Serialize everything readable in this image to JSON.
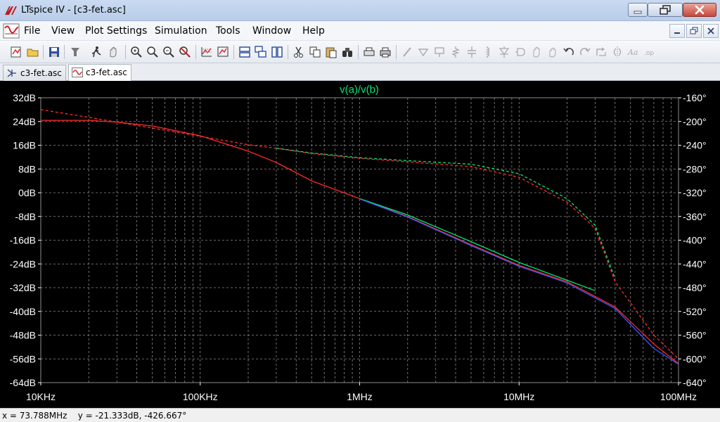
{
  "window": {
    "title": "LTspice IV - [c3-fet.asc]",
    "logo_icon": "ltspice-logo-icon",
    "controls": [
      "minimize-icon",
      "maximize-icon",
      "close-icon"
    ]
  },
  "menu": {
    "items": [
      "File",
      "View",
      "Plot Settings",
      "Simulation",
      "Tools",
      "Window",
      "Help"
    ],
    "mdi_controls": [
      "minimize-icon",
      "restore-icon",
      "close-icon"
    ]
  },
  "toolbar": {
    "icons": [
      "new-schematic-icon",
      "open-icon",
      "save-icon",
      "control-panel-icon",
      "run-icon",
      "halt-icon",
      "zoom-in-icon",
      "zoom-area-icon",
      "zoom-out-icon",
      "zoom-cancel-icon",
      "autorange-icon",
      "zoom-full-icon",
      "tile-horizontal-icon",
      "cascade-icon",
      "tile-vertical-icon",
      "cut-icon",
      "copy-icon",
      "paste-icon",
      "find-icon",
      "print-preview-icon",
      "print-icon",
      "wire-icon",
      "ground-icon",
      "label-icon",
      "resistor-icon",
      "capacitor-icon",
      "inductor-icon",
      "diode-icon",
      "component-icon",
      "move-icon",
      "drag-icon",
      "undo-icon",
      "redo-icon",
      "rotate-icon",
      "mirror-icon",
      "text-icon",
      "spice-directive-icon"
    ]
  },
  "tabs": [
    {
      "label": "c3-fet.asc",
      "icon": "schematic-icon",
      "active": false
    },
    {
      "label": "c3-fet.asc",
      "icon": "waveform-icon",
      "active": true
    }
  ],
  "status": {
    "text": "x = 73.788MHz    y = -21.333dB, -426.667°"
  },
  "colors": {
    "plot_background": "#000000",
    "grid": "#8c8c8c",
    "trace_green": "#00e676",
    "trace_red": "#ff2a2a",
    "trace_blue": "#3a5bff",
    "trace_magenta": "#e838ff",
    "trace_yellow": "#e6e600",
    "axis_text": "#ffffff"
  },
  "chart_data": {
    "type": "line",
    "title": "v(a)/v(b)",
    "xscale": "log",
    "x_ticks": [
      "10KHz",
      "100KHz",
      "1MHz",
      "10MHz",
      "100MHz"
    ],
    "xlim": [
      10000,
      100000000
    ],
    "y_left": {
      "ticks": [
        "32dB",
        "24dB",
        "16dB",
        "8dB",
        "0dB",
        "-8dB",
        "-16dB",
        "-24dB",
        "-32dB",
        "-40dB",
        "-48dB",
        "-56dB",
        "-64dB"
      ],
      "range": [
        -64,
        32
      ]
    },
    "y_right": {
      "ticks": [
        "-160°",
        "-200°",
        "-240°",
        "-280°",
        "-320°",
        "-360°",
        "-400°",
        "-440°",
        "-480°",
        "-520°",
        "-560°",
        "-600°",
        "-640°"
      ],
      "range": [
        -640,
        -160
      ]
    },
    "grid": true,
    "series": [
      {
        "style": "solid",
        "axis": "left",
        "color": "#ff2a2a",
        "x": [
          10000,
          20000,
          30000,
          50000,
          100000,
          200000,
          300000,
          500000,
          1000000,
          2000000,
          5000000,
          10000000,
          20000000,
          40000000,
          70000000,
          100000000
        ],
        "y": [
          24.4,
          24.4,
          23.8,
          22.5,
          19.2,
          14.0,
          10.2,
          4.0,
          -2.0,
          -8.0,
          -17.5,
          -24.5,
          -30.0,
          -38.5,
          -51.0,
          -57.6
        ]
      },
      {
        "style": "solid",
        "axis": "left",
        "color": "#00e676",
        "x": [
          1000000,
          2000000,
          5000000,
          10000000,
          20000000,
          30000000
        ],
        "y": [
          -2.0,
          -7.5,
          -16.5,
          -23.5,
          -29.5,
          -33.0
        ]
      },
      {
        "style": "solid",
        "axis": "left",
        "color": "#3a5bff",
        "x": [
          1000000,
          2000000,
          5000000,
          10000000,
          20000000,
          40000000,
          70000000,
          100000000
        ],
        "y": [
          -2.1,
          -8.2,
          -17.8,
          -24.8,
          -30.4,
          -39.0,
          -52.5,
          -57.8
        ]
      },
      {
        "style": "dashed",
        "axis": "right",
        "color": "#ff2a2a",
        "x": [
          10000,
          20000,
          30000,
          50000,
          100000,
          200000,
          300000,
          500000,
          1000000,
          2000000,
          5000000,
          10000000,
          20000000,
          30000000,
          40000000,
          70000000,
          100000000
        ],
        "y": [
          -180,
          -193,
          -201,
          -211,
          -225,
          -239,
          -245,
          -254,
          -262,
          -268,
          -276,
          -294,
          -336,
          -380,
          -470,
          -560,
          -600
        ]
      },
      {
        "style": "dashed",
        "axis": "right",
        "color": "#00e676",
        "x": [
          300000,
          500000,
          1000000,
          2000000,
          5000000,
          10000000,
          20000000,
          30000000,
          40000000
        ],
        "y": [
          -245,
          -253,
          -261,
          -266,
          -272,
          -288,
          -330,
          -375,
          -465
        ]
      }
    ]
  }
}
